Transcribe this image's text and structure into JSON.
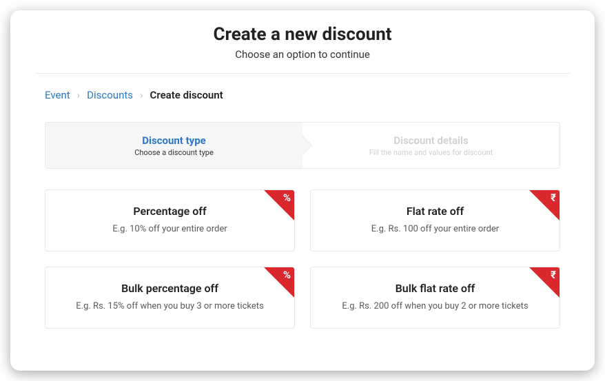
{
  "header": {
    "title": "Create a new discount",
    "subtitle": "Choose an option to continue"
  },
  "breadcrumb": {
    "event": "Event",
    "discounts": "Discounts",
    "current": "Create discount"
  },
  "stepper": {
    "step1": {
      "title": "Discount type",
      "sub": "Choose a discount type"
    },
    "step2": {
      "title": "Discount details",
      "sub": "Fill the name and values for discount"
    }
  },
  "options": {
    "percentage": {
      "title": "Percentage off",
      "desc": "E.g. 10% off your entire order",
      "icon": "%"
    },
    "flat": {
      "title": "Flat rate off",
      "desc": "E.g. Rs. 100 off your entire order",
      "icon": "₹"
    },
    "bulk_percentage": {
      "title": "Bulk percentage off",
      "desc": "E.g. Rs. 15% off when you buy 3 or more tickets",
      "icon": "%"
    },
    "bulk_flat": {
      "title": "Bulk flat rate off",
      "desc": "E.g. Rs. 200 off when you buy 2 or more tickets",
      "icon": "₹"
    }
  }
}
